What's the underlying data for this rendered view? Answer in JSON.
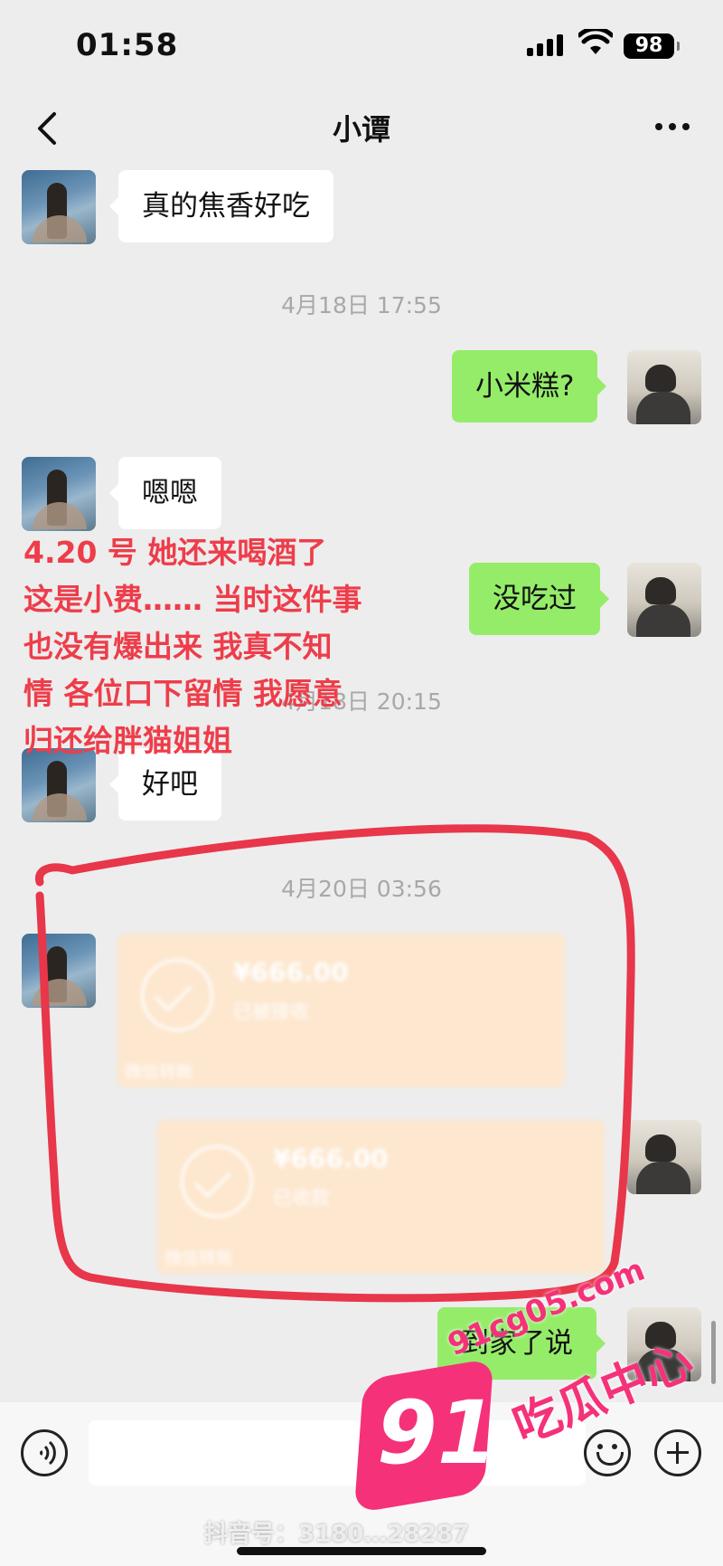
{
  "status_bar": {
    "time": "01:58",
    "battery": "98"
  },
  "header": {
    "title": "小谭"
  },
  "messages": {
    "m1": "真的焦香好吃",
    "t1": "4月18日 17:55",
    "m2": "小米糕?",
    "m3": "嗯嗯",
    "m4": "没吃过",
    "t2": "4月18日 20:15",
    "m5": "好吧",
    "t3": "4月20日 03:56",
    "transfer1": {
      "amount": "¥666.00",
      "status": "已被接收",
      "label": "微信转账"
    },
    "transfer2": {
      "amount": "¥666.00",
      "status": "已收款",
      "label": "微信转账"
    },
    "m6": "到家了说"
  },
  "annotation": {
    "lines": [
      "4.20 号 她还来喝酒了",
      "这是小费…… 当时这件事",
      "也没有爆出来 我真不知",
      "情 各位口下留情 我愿意",
      "归还给胖猫姐姐"
    ],
    "color": "#ee3d4a"
  },
  "watermarks": {
    "douyin": "抖音号：3180…28287",
    "site_number": "91",
    "site_domain": "91cg05.com",
    "site_name": "吃瓜中心"
  },
  "colors": {
    "outgoing_bubble": "#95ec69",
    "incoming_bubble": "#ffffff",
    "transfer_card": "#fde7cf",
    "logo": "#f5317a"
  }
}
